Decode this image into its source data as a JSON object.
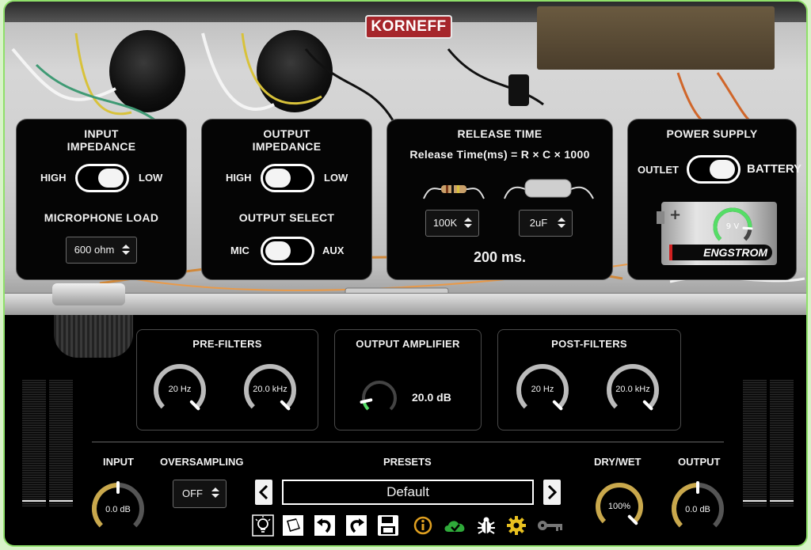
{
  "logo": "KORNEFF",
  "input_panel": {
    "title_line1": "INPUT",
    "title_line2": "IMPEDANCE",
    "high": "HIGH",
    "low": "LOW",
    "mic_load_title": "MICROPHONE LOAD",
    "mic_load_value": "600 ohm"
  },
  "output_panel": {
    "title_line1": "OUTPUT",
    "title_line2": "IMPEDANCE",
    "high": "HIGH",
    "low": "LOW",
    "select_title": "OUTPUT SELECT",
    "mic": "MIC",
    "aux": "AUX"
  },
  "release_panel": {
    "title": "RELEASE TIME",
    "formula": "Release Time(ms) = R × C × 1000",
    "resistor_value": "100K",
    "capacitor_value": "2uF",
    "result": "200 ms."
  },
  "power_panel": {
    "title": "POWER SUPPLY",
    "outlet": "OUTLET",
    "battery": "BATTERY",
    "battery_plus": "+",
    "battery_voltage": "9 V",
    "battery_brand": "ENGSTROM",
    "battery_level": 0.85
  },
  "pre_filters": {
    "title": "PRE-FILTERS",
    "low_value": "20 Hz",
    "high_value": "20.0 kHz"
  },
  "output_amp": {
    "title": "OUTPUT AMPLIFIER",
    "value": "20.0 dB",
    "level": 0.12
  },
  "post_filters": {
    "title": "POST-FILTERS",
    "low_value": "20 Hz",
    "high_value": "20.0 kHz"
  },
  "bottom": {
    "input_label": "INPUT",
    "input_value": "0.0 dB",
    "oversampling_label": "OVERSAMPLING",
    "oversampling_value": "OFF",
    "presets_label": "PRESETS",
    "preset_name": "Default",
    "drywet_label": "DRY/WET",
    "drywet_value": "100%",
    "output_label": "OUTPUT",
    "output_value": "0.0 dB"
  },
  "toolbar_icons": [
    "lightbulb-icon",
    "book-icon",
    "undo-icon",
    "redo-icon",
    "save-icon",
    "info-icon",
    "cloud-check-icon",
    "bug-icon",
    "gear-icon",
    "key-icon"
  ],
  "colors": {
    "gold": "#c9a84c",
    "green": "#55dd66",
    "panel": "#050505",
    "logo_red": "#a6262b"
  }
}
